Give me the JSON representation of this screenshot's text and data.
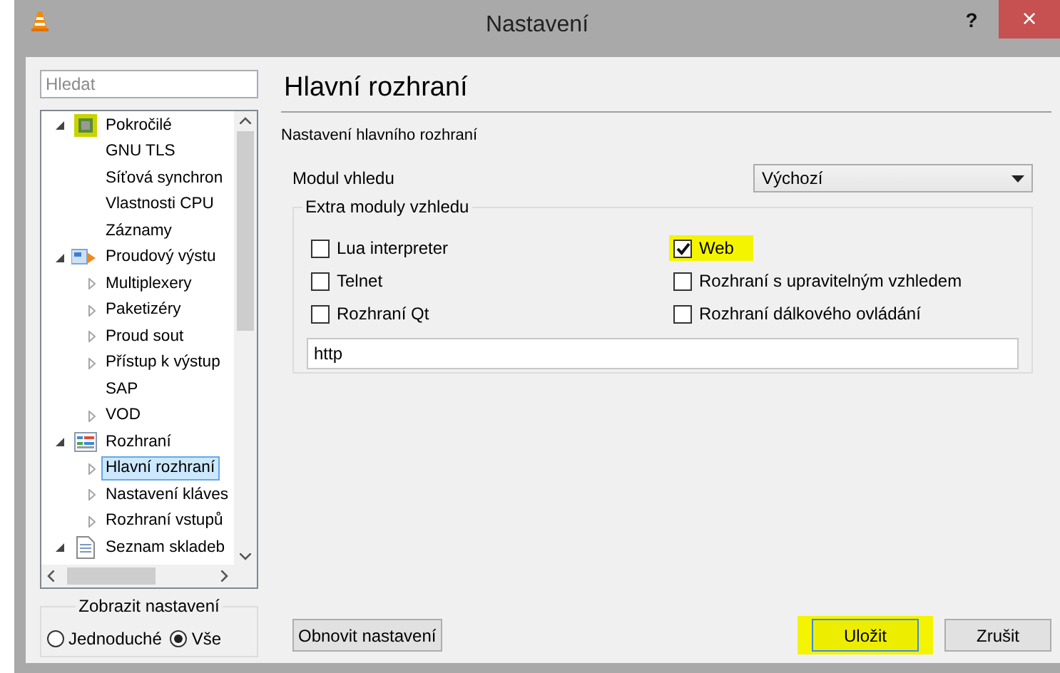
{
  "window": {
    "title": "Nastavení",
    "help": "?",
    "close": "×"
  },
  "search": {
    "placeholder": "Hledat"
  },
  "tree": [
    {
      "label": "Pokročilé",
      "kind": "expanded",
      "selected": false,
      "children": [
        {
          "label": "GNU TLS",
          "kind": "leaf",
          "selected": false
        },
        {
          "label": "Síťová synchron",
          "kind": "leaf",
          "selected": false
        },
        {
          "label": "Vlastnosti CPU",
          "kind": "leaf",
          "selected": false
        },
        {
          "label": "Záznamy",
          "kind": "leaf",
          "selected": false
        }
      ]
    },
    {
      "label": "Proudový výstu",
      "kind": "expanded",
      "selected": false,
      "children": [
        {
          "label": "Multiplexery",
          "kind": "collapsed",
          "selected": false
        },
        {
          "label": "Paketizéry",
          "kind": "collapsed",
          "selected": false
        },
        {
          "label": "Proud sout",
          "kind": "collapsed",
          "selected": false
        },
        {
          "label": "Přístup k výstup",
          "kind": "collapsed",
          "selected": false
        },
        {
          "label": "SAP",
          "kind": "leaf",
          "selected": false
        },
        {
          "label": "VOD",
          "kind": "collapsed",
          "selected": false
        }
      ]
    },
    {
      "label": "Rozhraní",
      "kind": "expanded",
      "selected": false,
      "children": [
        {
          "label": "Hlavní rozhraní",
          "kind": "collapsed",
          "selected": true
        },
        {
          "label": "Nastavení kláves",
          "kind": "collapsed",
          "selected": false
        },
        {
          "label": "Rozhraní vstupů",
          "kind": "collapsed",
          "selected": false
        }
      ]
    },
    {
      "label": "Seznam skladeb",
      "kind": "expanded",
      "selected": false
    }
  ],
  "view_mode": {
    "title": "Zobrazit nastavení",
    "options": [
      {
        "label": "Jednoduché",
        "selected": false
      },
      {
        "label": "Vše",
        "selected": true
      }
    ]
  },
  "panel": {
    "title": "Hlavní rozhraní",
    "subtitle": "Nastavení hlavního rozhraní",
    "skin": {
      "label": "Modul vhledu",
      "value": "Výchozí"
    },
    "extras": {
      "title": "Extra moduly vzhledu",
      "items": [
        {
          "label": "Lua interpreter",
          "checked": false,
          "highlighted": false
        },
        {
          "label": "Web",
          "checked": true,
          "highlighted": true
        },
        {
          "label": "Telnet",
          "checked": false,
          "highlighted": false
        },
        {
          "label": "Rozhraní s upravitelným vzhledem",
          "checked": false,
          "highlighted": false
        },
        {
          "label": "Rozhraní Qt",
          "checked": false,
          "highlighted": false
        },
        {
          "label": "Rozhraní dálkového ovládání",
          "checked": false,
          "highlighted": false
        }
      ],
      "value": "http"
    }
  },
  "buttons": {
    "reset": {
      "label": "Obnovit nastavení"
    },
    "actions": [
      {
        "label": "Uložit",
        "highlighted": true,
        "focused": true
      },
      {
        "label": "Zrušit",
        "highlighted": false,
        "focused": false
      }
    ]
  }
}
